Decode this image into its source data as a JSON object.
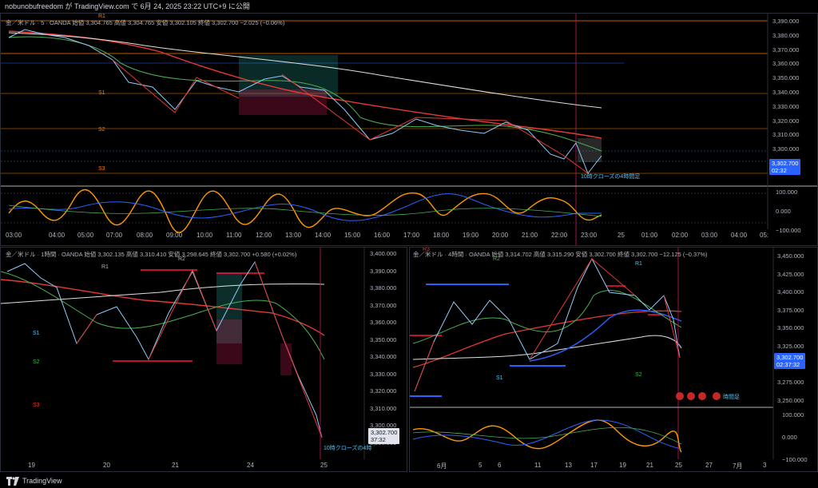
{
  "header": {
    "text": "nobunobufreedom が TradingView.com で 6月 24, 2025 23:22 UTC+9 に公開"
  },
  "panels": {
    "top": {
      "title": "金／米ドル · 5 · OANDA  始値 3,304.765  高値 3,304.765  安値 3,302.105  終値 3,302.700  −2.025 (−0.06%)",
      "price_axis": [
        "3,390.000",
        "3,380.000",
        "3,370.000",
        "3,360.000",
        "3,350.000",
        "3,340.000",
        "3,330.000",
        "3,320.000",
        "3,310.000",
        "3,300.000"
      ],
      "last_price": "3,302.700",
      "countdown": "02:32",
      "osc_axis": [
        "100.000",
        "0.000",
        "−100.000"
      ],
      "time_axis": [
        "03:00",
        "04:00",
        "05:00",
        "07:00",
        "08:00",
        "09:00",
        "10:00",
        "11:00",
        "12:00",
        "13:00",
        "14:00",
        "15:00",
        "16:00",
        "17:00",
        "18:00",
        "19:00",
        "20:00",
        "21:00",
        "22:00",
        "23:00",
        "25",
        "01:00",
        "02:00",
        "03:00",
        "04:00",
        "05:"
      ],
      "levels": [
        "R1",
        "S1",
        "S2",
        "S3"
      ],
      "annotation": "10時クローズの4時間足"
    },
    "left": {
      "title": "金／米ドル · 1時間 · OANDA  始値 3,302.135  高値 3,310.410  安値 3,298.645  終値 3,302.700  +0.580 (+0.02%)",
      "price_axis": [
        "3,400.000",
        "3,390.000",
        "3,380.000",
        "3,370.000",
        "3,360.000",
        "3,350.000",
        "3,340.000",
        "3,330.000",
        "3,320.000",
        "3,310.000",
        "3,300.000",
        "3,290.000"
      ],
      "last_price": "3,302.700",
      "countdown": "37:32",
      "time_axis": [
        "19",
        "20",
        "21",
        "24",
        "25"
      ],
      "levels": [
        "R1",
        "R2",
        "S1",
        "S2",
        "S3"
      ],
      "annotation": "10時クローズの4時"
    },
    "right": {
      "title": "金／米ドル · 4時間 · OANDA  始値 3,314.702  高値 3,315.290  安値 3,302.700  終値 3,302.700  −12.125 (−0.37%)",
      "price_axis": [
        "3,450.000",
        "3,425.000",
        "3,400.000",
        "3,375.000",
        "3,350.000",
        "3,325.000",
        "3,300.000",
        "3,275.000",
        "3,250.000"
      ],
      "last_price": "3,302.700",
      "countdown": "02:37:32",
      "osc_axis": [
        "100.000",
        "0.000",
        "−100.000"
      ],
      "time_axis": [
        "6月",
        "5",
        "6",
        "11",
        "13",
        "17",
        "19",
        "21",
        "25",
        "27",
        "7月",
        "3"
      ],
      "levels": [
        "R1",
        "R2",
        "R3",
        "S1",
        "S2"
      ],
      "annotation": "時間足"
    }
  },
  "footer": {
    "brand": "TradingView"
  },
  "colors": {
    "ma_red": "#e53935",
    "ma_green": "#4caf50",
    "ma_white": "#e0e0e0",
    "ma_blue": "#2962ff",
    "level_orange": "#f57c00",
    "osc_orange": "#ff9800"
  }
}
